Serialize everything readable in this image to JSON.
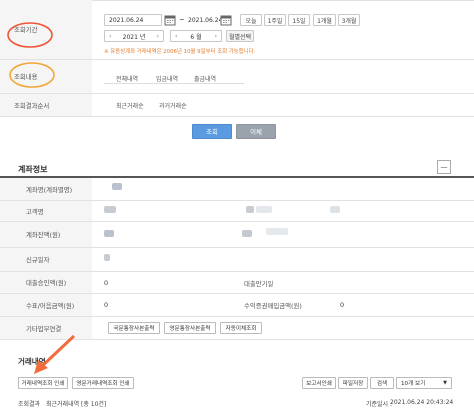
{
  "search": {
    "period_label": "조회기간",
    "start_date": "2021.06.24",
    "tilde": "~",
    "end_date": "2021.06.24",
    "quick": [
      "오늘",
      "1주일",
      "15일",
      "1개월",
      "3개월"
    ],
    "year_value": "2021 년",
    "month_value": "6 월",
    "month_select_label": "월별선택",
    "notice": "※ 유동성계좌 거래내역은 2006년 10월 9일부터 조회 가능합니다.",
    "content_label": "조회내용",
    "content_tabs": [
      "전체내역",
      "입금내역",
      "출금내역"
    ],
    "order_label": "조회결과순서",
    "order_tabs": [
      "최근거래순",
      "과거거래순"
    ],
    "submit": "조회",
    "reset": "이체"
  },
  "account": {
    "title": "계좌정보",
    "collapse": "—",
    "fields": {
      "name": "계좌명(계좌별명)",
      "customer": "고객명",
      "balance": "계좌잔액(원)",
      "opened": "신규일자",
      "loan_limit": "대출승인액(원)",
      "loan_limit_value": "0",
      "loan_due": "대출만기일",
      "check_amount": "수표/어음금액(원)",
      "check_amount_value": "0",
      "fee": "수익증권매입금액(원)",
      "fee_value": "0",
      "other": "기타업무연결"
    },
    "links": [
      "국문통장사본출력",
      "영문통장사본출력",
      "자동이체조회"
    ]
  },
  "transactions": {
    "title": "거래내역",
    "print_kr": "거래내역조회 인쇄",
    "print_en": "영문거래내역조회 인쇄",
    "report": "보고서인쇄",
    "save_file": "파일저장",
    "search": "검색",
    "per_page": "10개 보기",
    "result_label": "조회결과",
    "result_text": "최근거래내역 [총 10건]",
    "query_time_label": "기준일시 :",
    "query_time": "2021.06.24 20:43:24"
  },
  "colors": {
    "accent_blue": "#5a9ae0",
    "gray_button": "#9aa2ad",
    "annotation_red": "#f0553a",
    "annotation_orange": "#f4a636",
    "arrow": "#f26b3c"
  }
}
